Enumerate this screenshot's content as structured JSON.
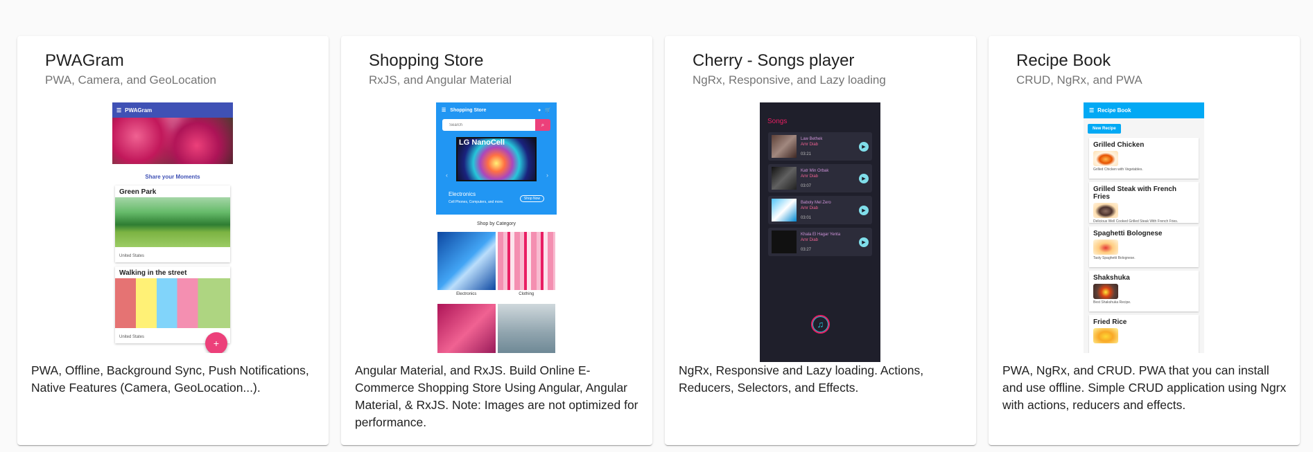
{
  "projects": [
    {
      "title": "PWAGram",
      "subtitle": "PWA, Camera, and GeoLocation",
      "description": "PWA, Offline, Background Sync, Push Notifications, Native Features (Camera, GeoLocation...).",
      "screenshot": {
        "app_title": "PWAGram",
        "share_label": "Share your Moments",
        "posts": [
          {
            "title": "Green Park",
            "location": "United States"
          },
          {
            "title": "Walking in the street",
            "location": "United States"
          }
        ],
        "fab_label": "+"
      }
    },
    {
      "title": "Shopping Store",
      "subtitle": "RxJS, and Angular Material",
      "description": "Angular Material, and RxJS. Build Online E-Commerce Shopping Store Using Angular, Angular Material, & RxJS. Note: Images are not optimized for performance.",
      "screenshot": {
        "app_title": "Shopping Store",
        "search_placeholder": "Search",
        "banner_brand": "LG NanoCell",
        "banner_category": "Electronics",
        "banner_subtitle": "Cell Phones, Computers, and more.",
        "banner_button": "Shop Now",
        "section_title": "Shop by Category",
        "categories": [
          "Electronics",
          "Clothing"
        ]
      }
    },
    {
      "title": "Cherry - Songs player",
      "subtitle": "NgRx, Responsive, and Lazy loading",
      "description": "NgRx, Responsive and Lazy loading. Actions, Reducers, Selectors, and Effects.",
      "screenshot": {
        "heading": "Songs",
        "songs": [
          {
            "title": "Law Bethek",
            "artist": "Amr Diab",
            "duration": "03:21"
          },
          {
            "title": "Katr Min Orbak",
            "artist": "Amr Diab",
            "duration": "03:07"
          },
          {
            "title": "Baboly Mel Zero",
            "artist": "Amr Diab",
            "duration": "03:01"
          },
          {
            "title": "Khala El Hagar Yenta",
            "artist": "Amr Diab",
            "duration": "03:27"
          }
        ]
      }
    },
    {
      "title": "Recipe Book",
      "subtitle": "CRUD, NgRx, and PWA",
      "description": "PWA, NgRx, and CRUD. PWA that you can install and use offline. Simple CRUD application using Ngrx with actions, reducers and effects.",
      "screenshot": {
        "app_title": "Recipe Book",
        "new_button": "New Recipe",
        "recipes": [
          {
            "name": "Grilled Chicken",
            "desc": "Grilled Chicken with Vegetables."
          },
          {
            "name": "Grilled Steak with French Fries",
            "desc": "Delicious Well Cooked Grilled Steak With French Fries."
          },
          {
            "name": "Spaghetti Bolognese",
            "desc": "Tasty Spaghetti Bolognese."
          },
          {
            "name": "Shakshuka",
            "desc": "Best Shakshuka Recipe."
          },
          {
            "name": "Fried Rice",
            "desc": ""
          }
        ]
      }
    }
  ]
}
